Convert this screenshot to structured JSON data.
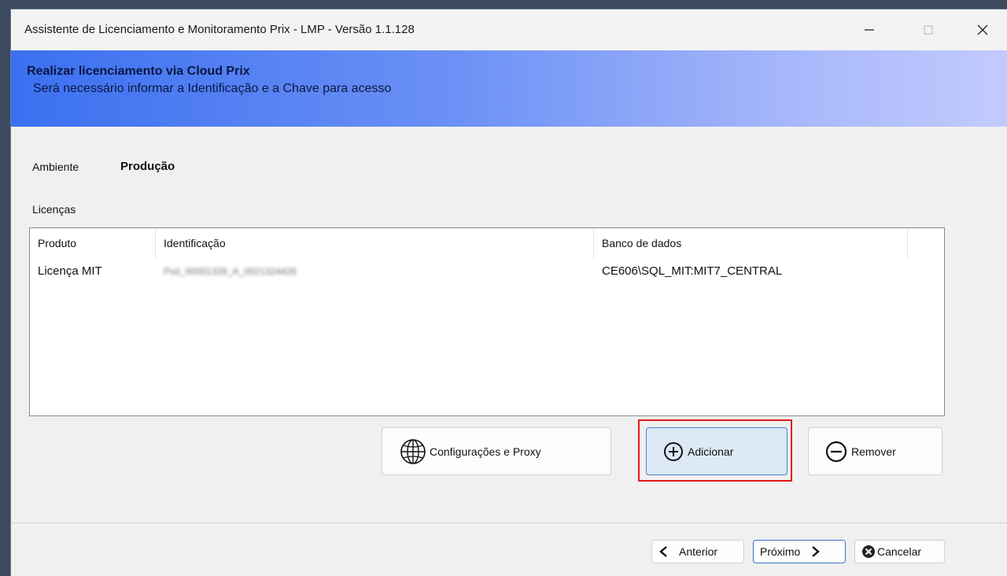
{
  "window": {
    "title": "Assistente de Licenciamento e Monitoramento Prix - LMP - Versão 1.1.128"
  },
  "banner": {
    "title": "Realizar licenciamento via Cloud Prix",
    "subtitle": "Será necessário informar a Identificação e a Chave para acesso"
  },
  "environment": {
    "label": "Ambiente",
    "value": "Produção"
  },
  "licenses": {
    "label": "Licenças",
    "columns": [
      "Produto",
      "Identificação",
      "Banco de dados"
    ],
    "rows": [
      {
        "produto": "Licença MIT",
        "identificacao": "Pvd_00001328_A_0021324426",
        "banco": "CE606\\SQL_MIT:MIT7_CENTRAL"
      }
    ]
  },
  "actions": {
    "config_label": "Configurações e Proxy",
    "add_label": "Adicionar",
    "remove_label": "Remover"
  },
  "nav": {
    "prev_label": "Anterior",
    "next_label": "Próximo",
    "cancel_label": "Cancelar"
  },
  "icons": {
    "minimize": "minimize-icon",
    "maximize": "maximize-icon",
    "close": "close-icon",
    "globe": "globe-icon",
    "plus": "plus-circle-icon",
    "minus": "minus-circle-icon",
    "chevron_left": "chevron-left-icon",
    "chevron_right": "chevron-right-icon",
    "x_circle": "x-circle-icon"
  },
  "colors": {
    "highlight": "#e21b1b",
    "banner_start": "#3b70f0",
    "banner_end": "#c2cbfd"
  }
}
